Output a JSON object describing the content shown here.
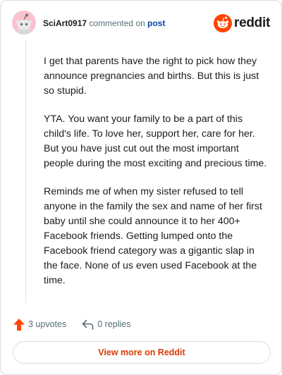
{
  "header": {
    "username": "SciArt0917",
    "commented_on_text": "commented on",
    "post_link": "post",
    "brand": "reddit"
  },
  "comment": {
    "paragraphs": [
      "I get that parents have the right to pick how they announce pregnancies and births. But this is just so stupid.",
      "YTA. You want your family to be a part of this child's life. To love her, support her, care for her. But you have just cut out the most important people during the most exciting and precious time.",
      "Reminds me of when my sister refused to tell anyone in the family the sex and name of her first baby until she could announce it to her 400+ Facebook friends. Getting lumped onto the Facebook friend category was a gigantic slap in the face. None of us even used Facebook at the time."
    ]
  },
  "actions": {
    "upvotes": "3 upvotes",
    "replies": "0 replies"
  },
  "footer": {
    "view_more": "View more on Reddit"
  },
  "icons": {
    "avatar": "snoo-avatar-icon",
    "brand": "reddit-logo-icon",
    "upvote": "upvote-arrow-icon",
    "reply": "reply-arrow-icon"
  },
  "colors": {
    "brand_orange": "#ff4500",
    "link_blue": "#0045ac",
    "view_more_text": "#d93a00",
    "avatar_bg": "#f8c3cf"
  }
}
